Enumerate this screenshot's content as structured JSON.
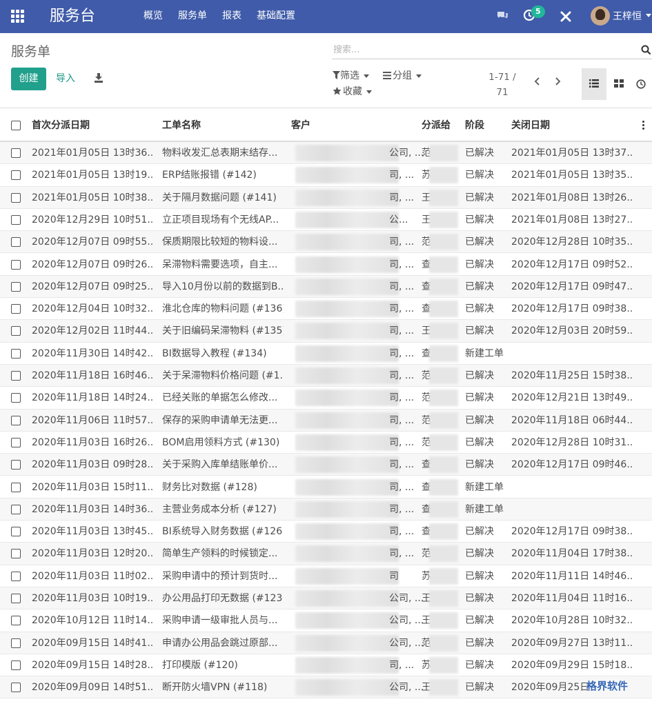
{
  "topbar": {
    "app_title": "服务台",
    "menu": [
      "概览",
      "服务单",
      "报表",
      "基础配置"
    ],
    "activity_count": "5",
    "user_name": "王梓恒"
  },
  "control": {
    "breadcrumb": "服务单",
    "search_placeholder": "搜索...",
    "create_label": "创建",
    "import_label": "导入",
    "filter_label": "筛选",
    "group_label": "分组",
    "favorite_label": "收藏",
    "pager_range": "1-71 /",
    "pager_total": "71"
  },
  "table": {
    "headers": {
      "first_dispatch": "首次分派日期",
      "ticket_name": "工单名称",
      "customer": "客户",
      "assigned_to": "分派给",
      "stage": "阶段",
      "close_date": "关闭日期"
    },
    "rows": [
      {
        "date": "2021年01月05日 13时36...",
        "name": "物料收发汇总表期末结存...",
        "cust": "公司, ...",
        "assign": "范",
        "stage": "已解决",
        "close": "2021年01月05日 13时37..."
      },
      {
        "date": "2021年01月05日 13时19...",
        "name": "ERP结账报错 (#142)",
        "cust": "司, ...",
        "assign": "苏",
        "stage": "已解决",
        "close": "2021年01月05日 13时35..."
      },
      {
        "date": "2021年01月05日 10时38...",
        "name": "关于隔月数据问题 (#141)",
        "cust": "司, ...",
        "assign": "王",
        "stage": "已解决",
        "close": "2021年01月08日 13时26..."
      },
      {
        "date": "2020年12月29日 10时51...",
        "name": "立正项目现场有个无线AP...",
        "cust": "公...",
        "assign": "王",
        "stage": "已解决",
        "close": "2021年01月08日 13时27..."
      },
      {
        "date": "2020年12月07日 09时55...",
        "name": "保质期限比较短的物料设...",
        "cust": "司, ...",
        "assign": "范",
        "stage": "已解决",
        "close": "2020年12月28日 10时35..."
      },
      {
        "date": "2020年12月07日 09时26...",
        "name": "呆滞物料需要选项，自主...",
        "cust": "司, ...",
        "assign": "查",
        "stage": "已解决",
        "close": "2020年12月17日 09时52..."
      },
      {
        "date": "2020年12月07日 09时25...",
        "name": "导入10月份以前的数据到B...",
        "cust": "司, ...",
        "assign": "查",
        "stage": "已解决",
        "close": "2020年12月17日 09时47..."
      },
      {
        "date": "2020年12月04日 10时32...",
        "name": "淮北仓库的物料问题 (#136)",
        "cust": "司, ...",
        "assign": "查",
        "stage": "已解决",
        "close": "2020年12月17日 09时38..."
      },
      {
        "date": "2020年12月02日 11时44...",
        "name": "关于旧编码呆滞物料 (#135)",
        "cust": "司, ...",
        "assign": "王",
        "stage": "已解决",
        "close": "2020年12月03日 20时59..."
      },
      {
        "date": "2020年11月30日 14时42...",
        "name": "BI数据导入教程 (#134)",
        "cust": "司, ...",
        "assign": "查",
        "stage": "新建工单",
        "close": ""
      },
      {
        "date": "2020年11月18日 16时46...",
        "name": "关于呆滞物料价格问题 (#1...",
        "cust": "司, ...",
        "assign": "范",
        "stage": "已解决",
        "close": "2020年11月25日 15时38..."
      },
      {
        "date": "2020年11月18日 14时24...",
        "name": "已经关账的单据怎么修改...",
        "cust": "司, ...",
        "assign": "范",
        "stage": "已解决",
        "close": "2020年12月21日 13时49..."
      },
      {
        "date": "2020年11月06日 11时57...",
        "name": "保存的采购申请单无法更...",
        "cust": "司, ...",
        "assign": "范",
        "stage": "已解决",
        "close": "2020年11月18日 06时44..."
      },
      {
        "date": "2020年11月03日 16时26...",
        "name": "BOM启用领料方式 (#130)",
        "cust": "司, ...",
        "assign": "范",
        "stage": "已解决",
        "close": "2020年12月28日 10时31..."
      },
      {
        "date": "2020年11月03日 09时28...",
        "name": "关于采购入库单结账单价...",
        "cust": "司, ...",
        "assign": "查",
        "stage": "已解决",
        "close": "2020年12月17日 09时46..."
      },
      {
        "date": "2020年11月03日 15时11...",
        "name": "财务比对数据 (#128)",
        "cust": "司, ...",
        "assign": "查",
        "stage": "新建工单",
        "close": ""
      },
      {
        "date": "2020年11月03日 14时36...",
        "name": "主营业务成本分析 (#127)",
        "cust": "司, ...",
        "assign": "查",
        "stage": "新建工单",
        "close": ""
      },
      {
        "date": "2020年11月03日 13时45...",
        "name": "BI系统导入财务数据 (#126",
        "cust": "司, ...",
        "assign": "查",
        "stage": "已解决",
        "close": "2020年12月17日 09时38..."
      },
      {
        "date": "2020年11月03日 12时20...",
        "name": "简单生产领料的时候锁定...",
        "cust": "司, ...",
        "assign": "范",
        "stage": "已解决",
        "close": "2020年11月04日 17时38..."
      },
      {
        "date": "2020年11月03日 11时02...",
        "name": "采购申请中的预计到货时...",
        "cust": "司",
        "assign": "苏",
        "stage": "已解决",
        "close": "2020年11月11日 14时46..."
      },
      {
        "date": "2020年11月03日 10时19...",
        "name": "办公用品打印无数据 (#123",
        "cust": "公司, ...",
        "assign": "王",
        "stage": "已解决",
        "close": "2020年11月04日 11时16..."
      },
      {
        "date": "2020年10月12日 11时14...",
        "name": "采购申请一级审批人员与...",
        "cust": "公司, ...",
        "assign": "王",
        "stage": "已解决",
        "close": "2020年10月28日 10时32..."
      },
      {
        "date": "2020年09月15日 14时41...",
        "name": "申请办公用品会跳过原部...",
        "cust": "公司, ...",
        "assign": "范",
        "stage": "已解决",
        "close": "2020年09月27日 13时11..."
      },
      {
        "date": "2020年09月15日 14时28...",
        "name": "打印模版 (#120)",
        "cust": "司, ...",
        "assign": "苏",
        "stage": "已解决",
        "close": "2020年09月29日 15时18..."
      },
      {
        "date": "2020年09月09日 14时51...",
        "name": "断开防火墙VPN (#118)",
        "cust": "公司, ...",
        "assign": "王",
        "stage": "已解决",
        "close": "2020年09月25日"
      }
    ]
  },
  "watermark": "格界软件",
  "colors": {
    "topbar": "#3f5ba9",
    "primary": "#21a08c",
    "badge": "#21b799"
  }
}
